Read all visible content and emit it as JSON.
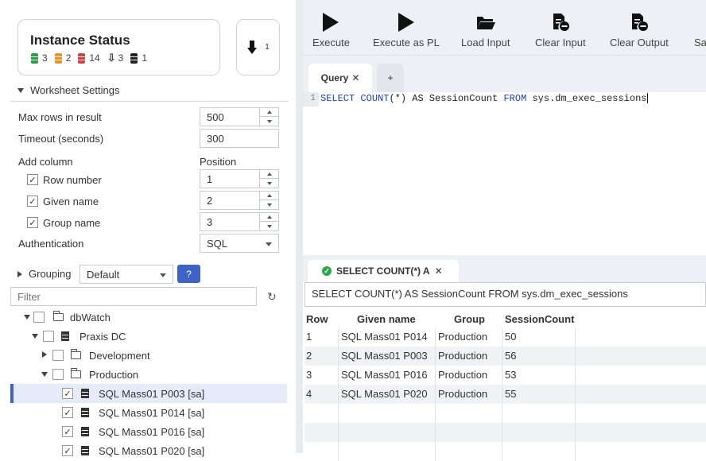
{
  "instance_status": {
    "title": "Instance Status",
    "counts": [
      {
        "icon": "db-green-icon",
        "color": "#2e9e44",
        "value": "3"
      },
      {
        "icon": "db-orange-icon",
        "color": "#e8922c",
        "value": "2"
      },
      {
        "icon": "db-red-icon",
        "color": "#d04040",
        "value": "14"
      },
      {
        "icon": "db-arrow-icon",
        "color": "#222222",
        "value": "3"
      },
      {
        "icon": "db-black-icon",
        "color": "#222222",
        "value": "1"
      }
    ],
    "download_badge": "1"
  },
  "worksheet_settings": {
    "heading": "Worksheet Settings",
    "max_rows_label": "Max rows in result",
    "max_rows_value": "500",
    "timeout_label": "Timeout (seconds)",
    "timeout_value": "300",
    "add_column_label": "Add column",
    "position_label": "Position",
    "columns": [
      {
        "label": "Row number",
        "checked": true,
        "position": "1"
      },
      {
        "label": "Given name",
        "checked": true,
        "position": "2"
      },
      {
        "label": "Group name",
        "checked": true,
        "position": "3"
      }
    ],
    "authentication_label": "Authentication",
    "authentication_value": "SQL"
  },
  "grouping": {
    "label": "Grouping",
    "value": "Default",
    "help": "?"
  },
  "filter": {
    "placeholder": "Filter"
  },
  "tree": [
    {
      "label": "dbWatch"
    },
    {
      "label": "Praxis DC"
    },
    {
      "label": "Development"
    },
    {
      "label": "Production"
    },
    {
      "label": "SQL Mass01 P003 [sa]"
    },
    {
      "label": "SQL Mass01 P014 [sa]"
    },
    {
      "label": "SQL Mass01 P016 [sa]"
    },
    {
      "label": "SQL Mass01 P020 [sa]"
    }
  ],
  "toolbar": {
    "execute": "Execute",
    "execute_pl": "Execute as PL",
    "load_input": "Load Input",
    "clear_input": "Clear Input",
    "clear_output": "Clear Output",
    "save": "Sa"
  },
  "query_tab": {
    "label": "Query",
    "close": "✕",
    "plus": "+"
  },
  "editor": {
    "line": "1",
    "code_kw1": "SELECT",
    "code_kw2": "COUNT",
    "code_mid": "(*) AS SessionCount ",
    "code_kw3": "FROM",
    "code_end": " sys.dm_exec_sessions"
  },
  "result_tab": {
    "label": "SELECT COUNT(*) A",
    "close": "✕",
    "check": "✓"
  },
  "result_query": "SELECT COUNT(*) AS SessionCount FROM sys.dm_exec_sessions",
  "result": {
    "columns": [
      "Row",
      "Given name",
      "Group",
      "SessionCount"
    ],
    "rows": [
      [
        "1",
        "SQL Mass01 P014",
        "Production",
        "50"
      ],
      [
        "2",
        "SQL Mass01 P003",
        "Production",
        "56"
      ],
      [
        "3",
        "SQL Mass01 P016",
        "Production",
        "53"
      ],
      [
        "4",
        "SQL Mass01 P020",
        "Production",
        "55"
      ]
    ]
  }
}
